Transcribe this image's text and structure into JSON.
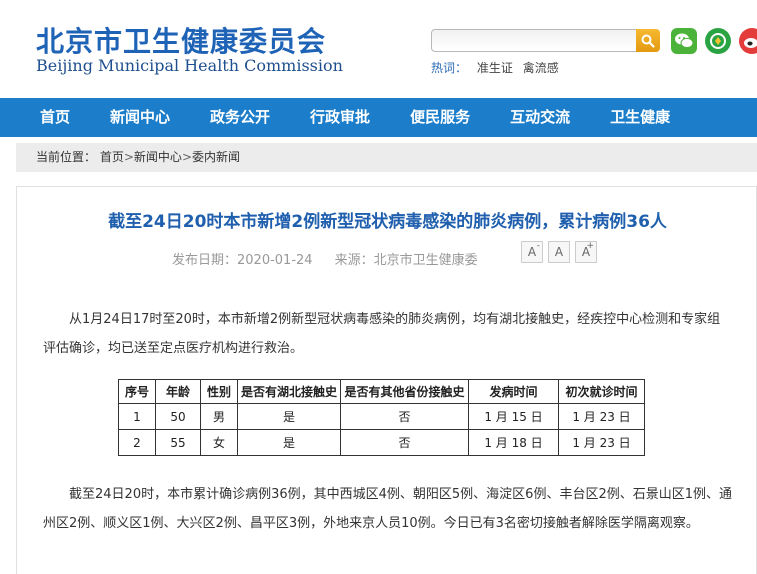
{
  "header": {
    "logo_cn": "北京市卫生健康委员会",
    "logo_en": "Beijing Municipal Health Commission",
    "search": {
      "placeholder": "",
      "value": ""
    },
    "hot_label": "热词：",
    "hot_words": [
      "准生证",
      "禽流感"
    ],
    "social_icons": [
      "wechat-icon",
      "app-icon",
      "weibo-icon"
    ]
  },
  "nav": {
    "items": [
      "首页",
      "新闻中心",
      "政务公开",
      "行政审批",
      "便民服务",
      "互动交流",
      "卫生健康"
    ]
  },
  "breadcrumb": {
    "prefix": "当前位置：",
    "items": [
      "首页",
      "新闻中心",
      "委内新闻"
    ],
    "separator": ">"
  },
  "article": {
    "title": "截至24日20时本市新增2例新型冠状病毒感染的肺炎病例，累计病例36人",
    "date": "发布日期：2020-01-24",
    "source": "来源：北京市卫生健康委",
    "font_buttons": {
      "smaller": "A",
      "smaller_sup": "-",
      "normal": "A",
      "larger": "A",
      "larger_sup": "+"
    },
    "para1": "从1月24日17时至20时，本市新增2例新型冠状病毒感染的肺炎病例，均有湖北接触史，经疾控中心检测和专家组评估确诊，均已送至定点医疗机构进行救治。",
    "table": {
      "headers": [
        "序号",
        "年龄",
        "性别",
        "是否有湖北接触史",
        "是否有其他省份接触史",
        "发病时间",
        "初次就诊时间"
      ],
      "rows": [
        [
          "1",
          "50",
          "男",
          "是",
          "否",
          "1 月 15 日",
          "1 月 23 日"
        ],
        [
          "2",
          "55",
          "女",
          "是",
          "否",
          "1 月 18 日",
          "1 月 23 日"
        ]
      ]
    },
    "para2": "截至24日20时，本市累计确诊病例36例，其中西城区4例、朝阳区5例、海淀区6例、丰台区2例、石景山区1例、通州区2例、顺义区1例、大兴区2例、昌平区3例，外地来京人员10例。今日已有3名密切接触者解除医学隔离观察。"
  },
  "colors": {
    "brand_blue": "#1f63b7",
    "nav_blue": "#1c7ecb",
    "title_blue": "#1f5fae",
    "search_orange": "#e49a10"
  }
}
